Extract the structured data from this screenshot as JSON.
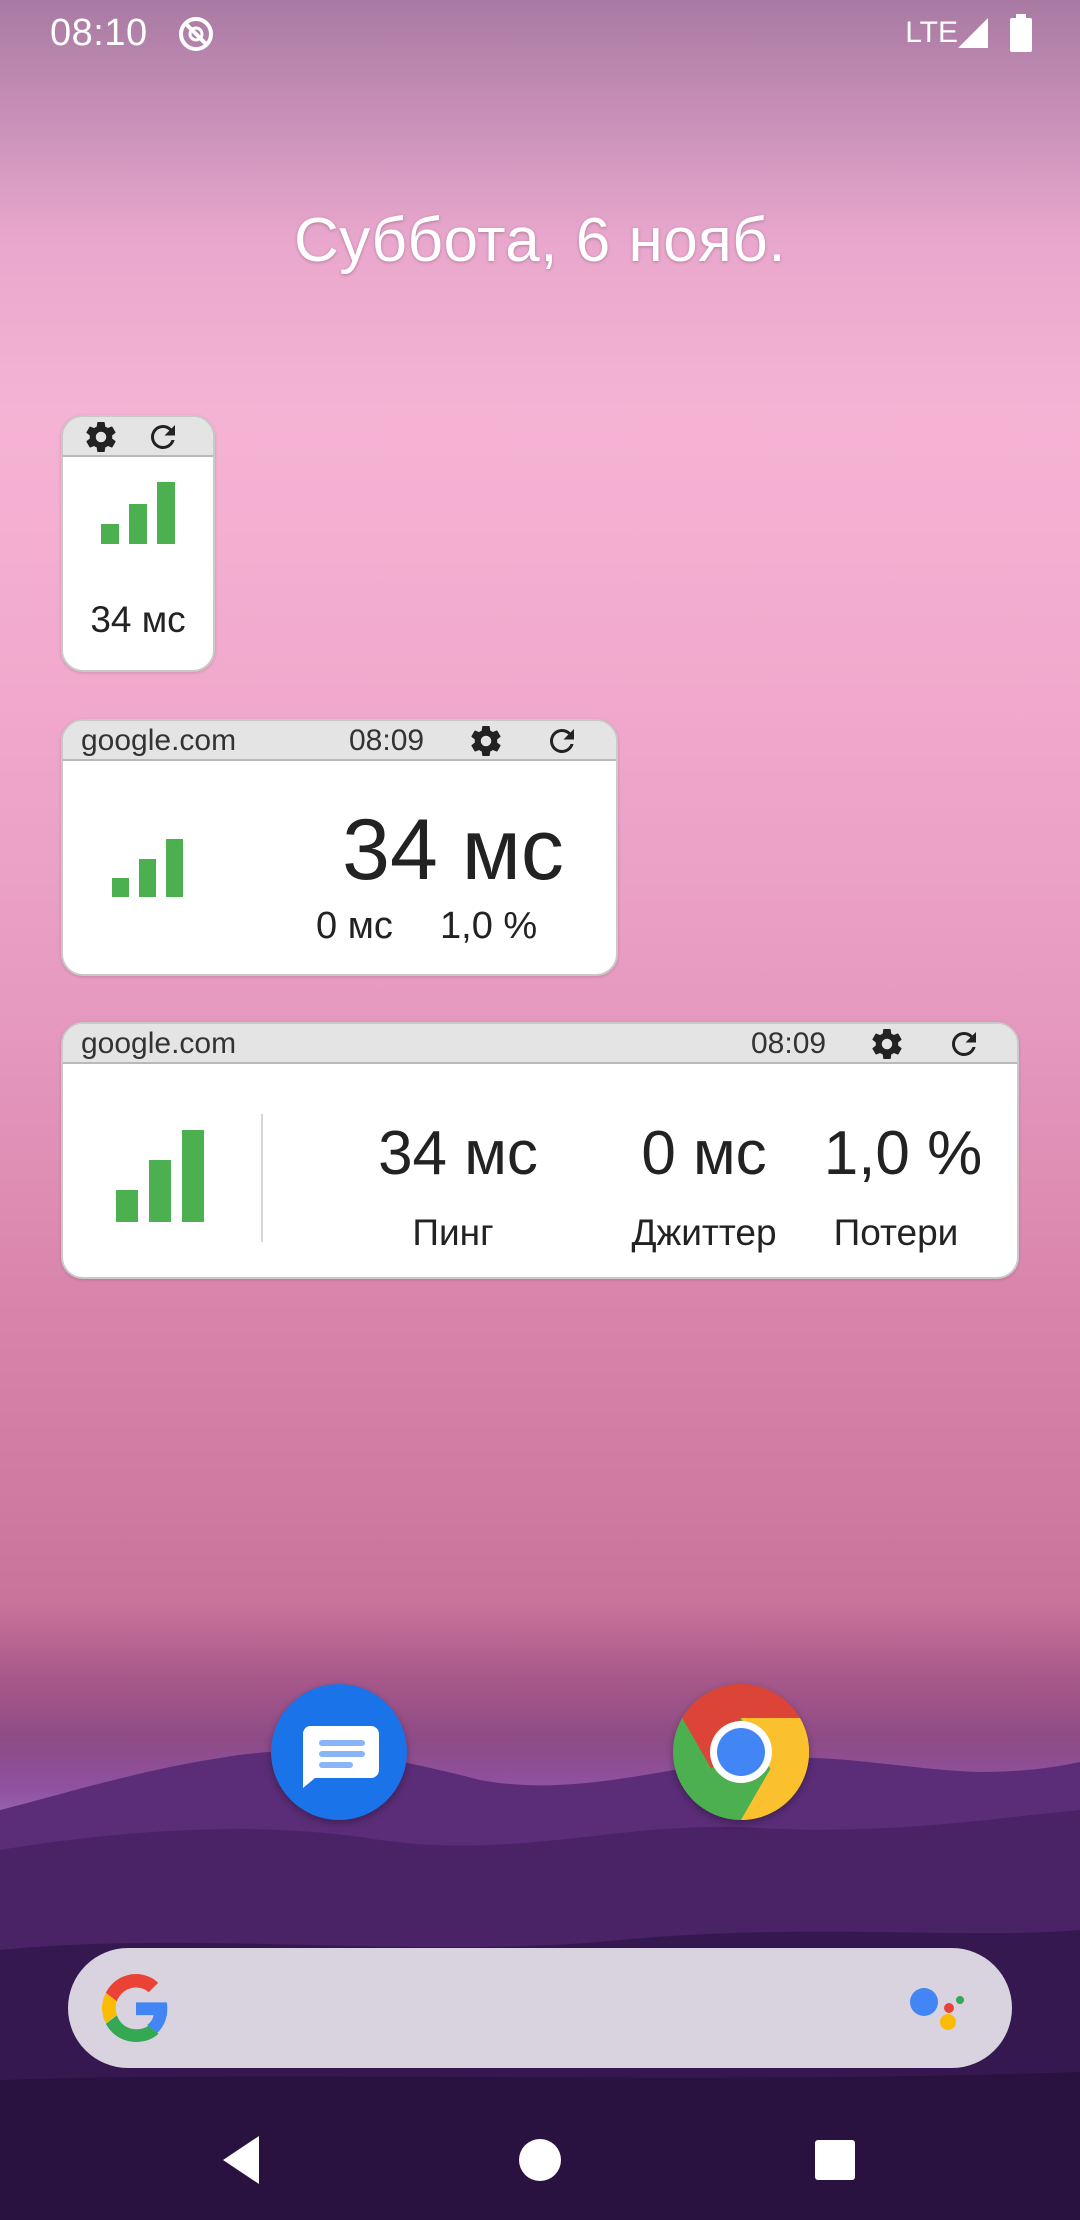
{
  "status_bar": {
    "time": "08:10",
    "network": "LTE",
    "dnd_icon": "do-not-disturb-icon",
    "signal_icon": "cell-signal-icon",
    "battery_icon": "battery-icon"
  },
  "date": "Суббота, 6 нояб.",
  "widgets": {
    "small": {
      "ping": "34 мс",
      "signal_level": 3
    },
    "medium": {
      "host": "google.com",
      "time": "08:09",
      "ping": "34 мс",
      "jitter": "0 мс",
      "loss": "1,0 %",
      "signal_level": 3
    },
    "large": {
      "host": "google.com",
      "time": "08:09",
      "ping": "34 мс",
      "jitter": "0 мс",
      "loss": "1,0 %",
      "ping_label": "Пинг",
      "jitter_label": "Джиттер",
      "loss_label": "Потери",
      "signal_level": 3
    }
  },
  "dock": {
    "apps": [
      "messages-icon",
      "chrome-icon"
    ]
  },
  "search_bar": {
    "logo_icon": "google-g-icon",
    "assistant_icon": "google-assistant-icon"
  },
  "nav_bar": {
    "buttons": [
      "back-icon",
      "home-icon",
      "recents-icon"
    ]
  },
  "colors": {
    "signal_green": "#4caf50",
    "widget_header": "#e4e4e4",
    "messages_blue": "#1a73e8"
  }
}
